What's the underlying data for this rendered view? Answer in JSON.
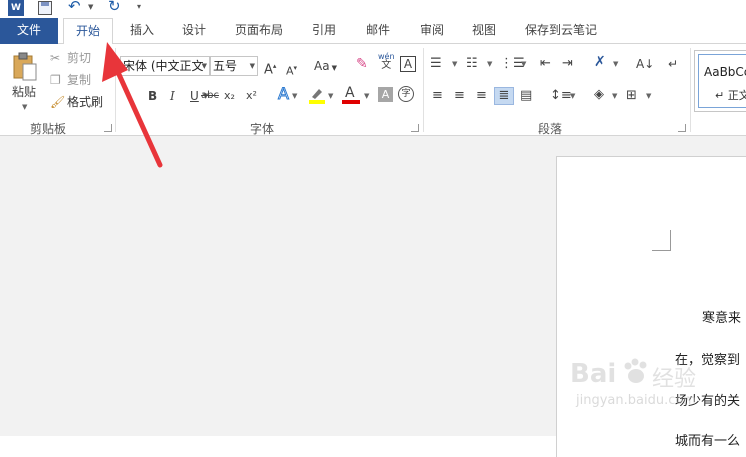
{
  "tabs": {
    "file": "文件",
    "home": "开始",
    "insert": "插入",
    "design": "设计",
    "layout": "页面布局",
    "references": "引用",
    "mailings": "邮件",
    "review": "审阅",
    "view": "视图",
    "save_cloud": "保存到云笔记"
  },
  "clipboard": {
    "paste": "粘贴",
    "cut": "剪切",
    "copy": "复制",
    "format_painter": "格式刷",
    "group_label": "剪贴板"
  },
  "font": {
    "font_name": "宋体 (中文正文",
    "font_size": "五号",
    "case_label": "Aa",
    "bold": "B",
    "italic": "I",
    "underline": "U",
    "strike": "abc",
    "subscript": "x₂",
    "superscript": "x²",
    "phonetic_top": "wén",
    "phonetic_bottom": "文",
    "char_border": "A",
    "text_effect": "A",
    "font_color": "A",
    "char_shading": "A",
    "enclose": "字",
    "grow": "A",
    "shrink": "A",
    "group_label": "字体"
  },
  "paragraph": {
    "group_label": "段落"
  },
  "styles": {
    "preview": "AaBbCc",
    "normal": "↵ 正文"
  },
  "document": {
    "line1": "寒意来",
    "line2": "在，觉察到",
    "line3": "场少有的关",
    "line4": "城而有一么"
  },
  "watermark": {
    "brand": "Bai",
    "brand2": "经验",
    "url": "jingyan.baidu.com"
  },
  "colors": {
    "accent": "#2b579a",
    "arrow": "#e8353a",
    "highlight_yellow": "#ffff00",
    "font_red": "#e00000"
  }
}
